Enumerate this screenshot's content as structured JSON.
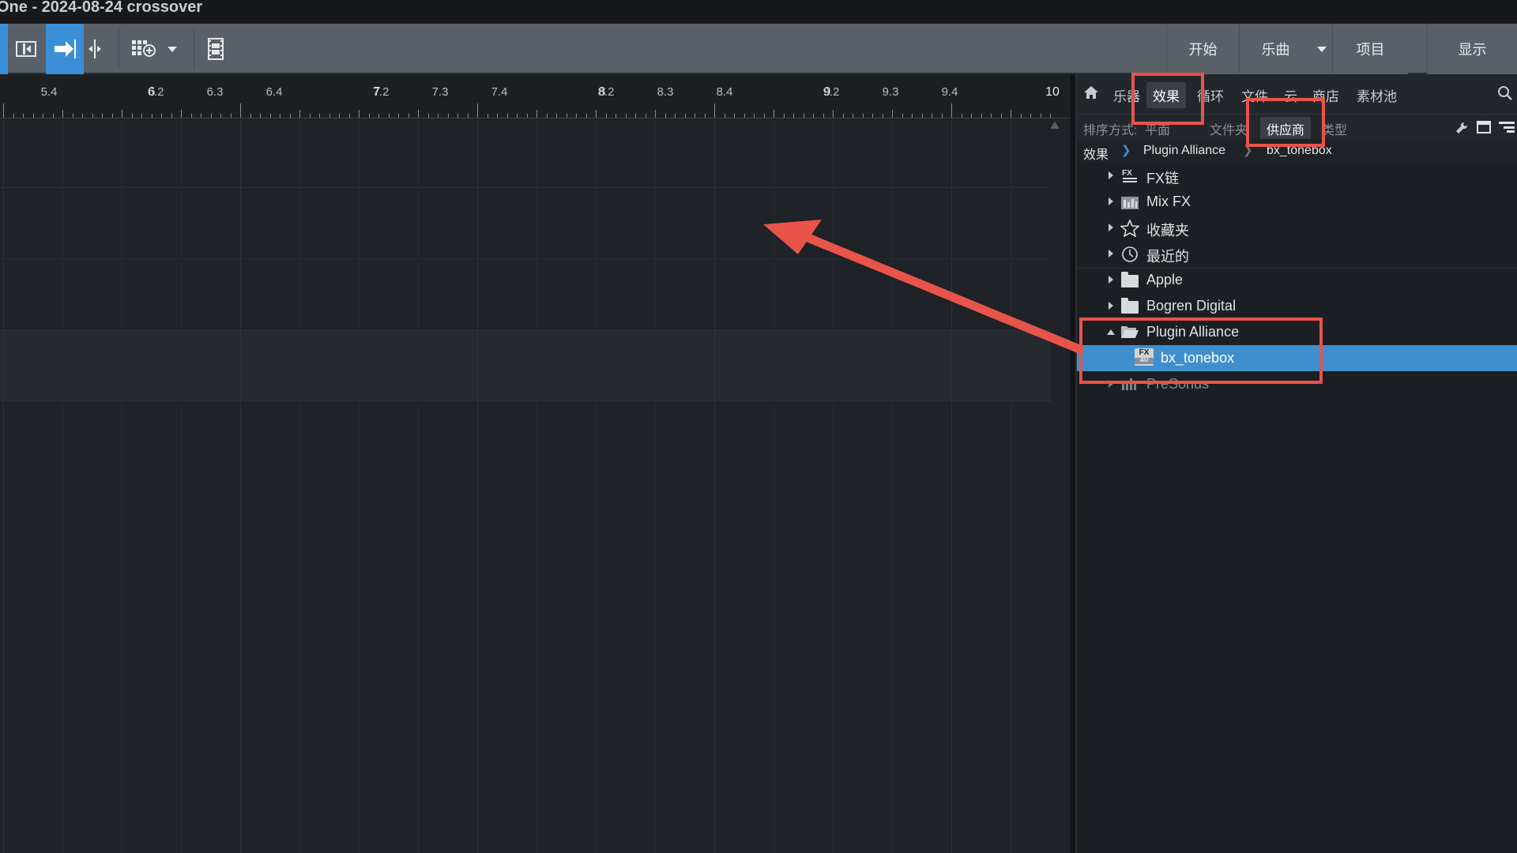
{
  "window": {
    "title": "One - 2024-08-24 crossover"
  },
  "toolbar": {
    "nav": [
      "开始",
      "乐曲",
      "项目",
      "显示"
    ]
  },
  "ruler": {
    "labels": [
      {
        "text": "5.4",
        "major": false
      },
      {
        "text": "6",
        "major": true
      },
      {
        "text": "6.2",
        "major": false
      },
      {
        "text": "6.3",
        "major": false
      },
      {
        "text": "6.4",
        "major": false
      },
      {
        "text": "7",
        "major": true
      },
      {
        "text": "7.2",
        "major": false
      },
      {
        "text": "7.3",
        "major": false
      },
      {
        "text": "7.4",
        "major": false
      },
      {
        "text": "8",
        "major": true
      },
      {
        "text": "8.2",
        "major": false
      },
      {
        "text": "8.3",
        "major": false
      },
      {
        "text": "8.4",
        "major": false
      },
      {
        "text": "9",
        "major": true
      },
      {
        "text": "9.2",
        "major": false
      },
      {
        "text": "9.3",
        "major": false
      },
      {
        "text": "9.4",
        "major": false
      },
      {
        "text": "10",
        "major": true
      }
    ]
  },
  "browser": {
    "tabs": [
      {
        "label": "乐器",
        "active": false
      },
      {
        "label": "效果",
        "active": true
      },
      {
        "label": "循环",
        "active": false
      },
      {
        "label": "文件",
        "active": false
      },
      {
        "label": "云",
        "active": false
      },
      {
        "label": "商店",
        "active": false
      },
      {
        "label": "素材池",
        "active": false
      }
    ],
    "sort": {
      "label": "排序方式:",
      "options": [
        {
          "label": "平面",
          "active": false
        },
        {
          "label": "文件夹",
          "active": false
        },
        {
          "label": "供应商",
          "active": true
        },
        {
          "label": "类型",
          "active": false
        }
      ]
    },
    "breadcrumb": [
      "效果",
      "Plugin Alliance",
      "bx_tonebox"
    ],
    "tree": [
      {
        "label": "FX链",
        "icon": "fx-chain-icon",
        "expanded": false
      },
      {
        "label": "Mix FX",
        "icon": "mix-fx-icon",
        "expanded": false
      },
      {
        "label": "收藏夹",
        "icon": "star-icon",
        "expanded": false
      },
      {
        "label": "最近的",
        "icon": "clock-icon",
        "expanded": false
      },
      {
        "label": "Apple",
        "icon": "folder-icon",
        "expanded": false
      },
      {
        "label": "Bogren Digital",
        "icon": "folder-icon",
        "expanded": false
      },
      {
        "label": "Plugin Alliance",
        "icon": "folder-open-icon",
        "expanded": true
      },
      {
        "label": "bx_tonebox",
        "icon": "fx-au-icon",
        "selected": true
      },
      {
        "label": "PreSonus",
        "icon": "presonus-icon",
        "expanded": false
      }
    ]
  },
  "annotation": {
    "highlight_color": "#e8534a",
    "accent_color": "#3f8fce"
  }
}
